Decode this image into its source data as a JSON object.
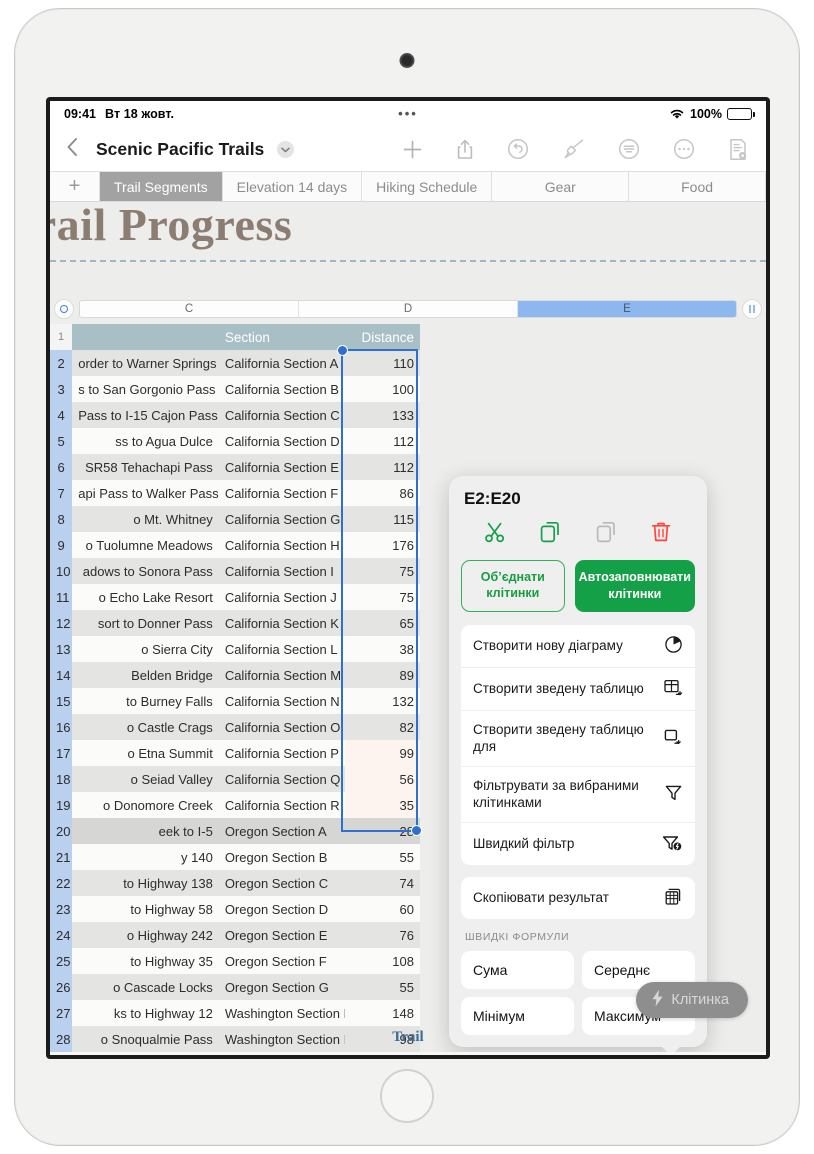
{
  "status_bar": {
    "time": "09:41",
    "date": "Вт 18 жовт.",
    "battery_percent": "100%",
    "wifi_icon": "wifi-icon",
    "battery_icon": "battery-icon",
    "dots": "•••"
  },
  "nav_bar": {
    "back_icon": "chevron-left-icon",
    "document_title": "Scenic Pacific Trails",
    "title_chevron_icon": "chevron-down-icon",
    "tools": [
      {
        "name": "add-button",
        "icon": "plus-icon"
      },
      {
        "name": "share-button",
        "icon": "share-icon"
      },
      {
        "name": "undo-button",
        "icon": "undo-icon"
      },
      {
        "name": "format-button",
        "icon": "paintbrush-icon"
      },
      {
        "name": "insert-button",
        "icon": "text-format-icon"
      },
      {
        "name": "more-button",
        "icon": "ellipsis-circle-icon"
      },
      {
        "name": "document-options-button",
        "icon": "document-view-icon"
      }
    ]
  },
  "sheet_tabs": {
    "add_label": "+",
    "tabs": [
      {
        "label": "Trail Segments",
        "active": true
      },
      {
        "label": "Elevation 14 days",
        "active": false
      },
      {
        "label": "Hiking Schedule",
        "active": false
      },
      {
        "label": "Gear",
        "active": false
      },
      {
        "label": "Food",
        "active": false
      }
    ]
  },
  "canvas": {
    "sheet_title": "Trail Progress",
    "bottom_label": "Trail"
  },
  "column_bar": {
    "knob_icon": "selection-knob-icon",
    "columns": [
      {
        "label": "C",
        "selected": false
      },
      {
        "label": "D",
        "selected": false
      },
      {
        "label": "E",
        "selected": true
      }
    ],
    "pause_icon": "pause-handle-icon"
  },
  "table": {
    "headers": {
      "trail": "",
      "section": "Section",
      "distance": "Distance"
    },
    "header_row_number": "1",
    "rows": [
      {
        "n": "2",
        "trail": "order to Warner Springs",
        "section": "California Section A",
        "distance": "110"
      },
      {
        "n": "3",
        "trail": "s to San Gorgonio Pass",
        "section": "California Section B",
        "distance": "100"
      },
      {
        "n": "4",
        "trail": " Pass to I-15 Cajon Pass",
        "section": "California Section C",
        "distance": "133"
      },
      {
        "n": "5",
        "trail": "ss to Agua Dulce",
        "section": "California Section D",
        "distance": "112"
      },
      {
        "n": "6",
        "trail": " SR58 Tehachapi Pass",
        "section": "California Section E",
        "distance": "112"
      },
      {
        "n": "7",
        "trail": "api Pass to Walker Pass",
        "section": "California Section F",
        "distance": "86"
      },
      {
        "n": "8",
        "trail": "o Mt. Whitney",
        "section": "California Section G",
        "distance": "115"
      },
      {
        "n": "9",
        "trail": "o Tuolumne Meadows",
        "section": "California Section H",
        "distance": "176"
      },
      {
        "n": "10",
        "trail": "adows to Sonora Pass",
        "section": "California Section I",
        "distance": "75"
      },
      {
        "n": "11",
        "trail": "o Echo Lake Resort",
        "section": "California Section J",
        "distance": "75"
      },
      {
        "n": "12",
        "trail": "sort to Donner Pass",
        "section": "California Section K",
        "distance": "65"
      },
      {
        "n": "13",
        "trail": "o Sierra City",
        "section": "California Section L",
        "distance": "38"
      },
      {
        "n": "14",
        "trail": "Belden Bridge",
        "section": "California Section M",
        "distance": "89"
      },
      {
        "n": "15",
        "trail": " to Burney Falls",
        "section": "California Section N",
        "distance": "132"
      },
      {
        "n": "16",
        "trail": "o Castle Crags",
        "section": "California Section O",
        "distance": "82"
      },
      {
        "n": "17",
        "trail": "o Etna Summit",
        "section": "California Section P",
        "distance": "99"
      },
      {
        "n": "18",
        "trail": "o Seiad Valley",
        "section": "California Section Q",
        "distance": "56"
      },
      {
        "n": "19",
        "trail": "o Donomore Creek",
        "section": "California Section R",
        "distance": "35"
      },
      {
        "n": "20",
        "trail": "eek to I-5",
        "section": "Oregon Section A",
        "distance": "28"
      },
      {
        "n": "21",
        "trail": "y 140",
        "section": "Oregon Section B",
        "distance": "55"
      },
      {
        "n": "22",
        "trail": "to Highway 138",
        "section": "Oregon Section C",
        "distance": "74"
      },
      {
        "n": "23",
        "trail": "to Highway 58",
        "section": "Oregon Section D",
        "distance": "60"
      },
      {
        "n": "24",
        "trail": "o Highway 242",
        "section": "Oregon Section E",
        "distance": "76"
      },
      {
        "n": "25",
        "trail": "to Highway 35",
        "section": "Oregon Section F",
        "distance": "108"
      },
      {
        "n": "26",
        "trail": "o Cascade Locks",
        "section": "Oregon Section G",
        "distance": "55"
      },
      {
        "n": "27",
        "trail": "ks to Highway 12",
        "section": "Washington Section H",
        "distance": "148"
      },
      {
        "n": "28",
        "trail": "o Snoqualmie Pass",
        "section": "Washington Section I",
        "distance": "98"
      }
    ]
  },
  "popover": {
    "range_title": "E2:E20",
    "action_icons": [
      {
        "name": "cut-icon",
        "color": "#14a047"
      },
      {
        "name": "copy-icon",
        "color": "#14a047"
      },
      {
        "name": "paste-icon",
        "color": "#b9b9b9"
      },
      {
        "name": "delete-icon",
        "color": "#ff453a"
      }
    ],
    "merge_label": "Об’єднати клітинки",
    "autofill_label": "Автозаповнювати клітинки",
    "menu_groups": [
      [
        {
          "label": "Створити нову діаграму",
          "icon": "pie-chart-icon"
        },
        {
          "label": "Створити зведену таблицю",
          "icon": "pivot-table-icon"
        },
        {
          "label": "Створити зведену таблицю для",
          "icon": "pivot-for-icon"
        },
        {
          "label": "Фільтрувати за вибраними клітинками",
          "icon": "filter-icon"
        },
        {
          "label": "Швидкий фільтр",
          "icon": "quick-filter-icon"
        }
      ],
      [
        {
          "label": "Скопіювати результат",
          "icon": "copy-result-icon"
        }
      ]
    ],
    "formulas_label": "ШВИДКІ ФОРМУЛИ",
    "formulas": [
      "Сума",
      "Середнє",
      "Мінімум",
      "Максимум"
    ]
  },
  "cell_pill": {
    "icon": "lightning-bolt-icon",
    "label": "Клітинка"
  },
  "colors": {
    "accent_green": "#14a047",
    "selection_blue": "#2f6fd0",
    "header_teal": "#a8bfc6",
    "title_brown": "#8b7d72",
    "tab_active_gray": "#a2a2a2"
  }
}
